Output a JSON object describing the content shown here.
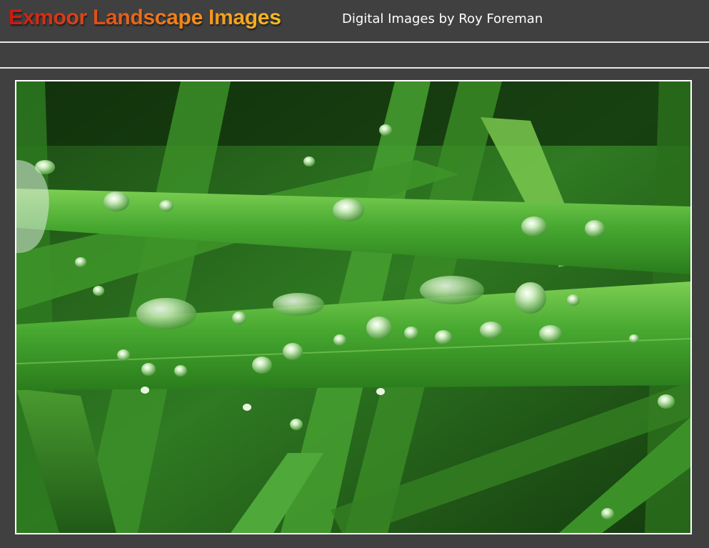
{
  "site": {
    "title": "Exmoor Landscape Images",
    "tagline": "Digital Images by Roy Foreman"
  },
  "colors": {
    "background": "#404040",
    "rule": "#e8e8e8",
    "title_gradient_start": "#c81a12",
    "title_gradient_end": "#f6bb22",
    "tagline": "#ffffff"
  },
  "photo": {
    "subject": "green grass blades with water droplets"
  }
}
